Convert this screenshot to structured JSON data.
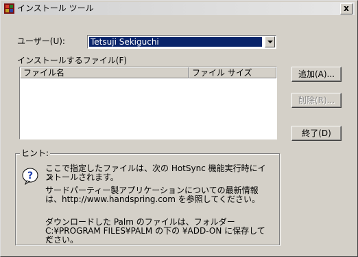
{
  "window": {
    "title": "インストール ツール",
    "close_label": "x"
  },
  "user": {
    "label": "ユーザー(U):",
    "selected": "Tetsuji Sekiguchi"
  },
  "files": {
    "label": "インストールするファイル(F)",
    "columns": [
      "ファイル名",
      "ファイル サイズ"
    ],
    "rows": []
  },
  "buttons": {
    "add": "追加(A)...",
    "delete": "削除(R)...",
    "exit": "終了(D)"
  },
  "hints": {
    "legend": "ヒント:",
    "line1a": "ここで指定したファイルは、次の HotSync 機能実行時にイン",
    "line1b": "ストールされます。",
    "line2a": "サードパーティー製アプリケーションについての最新情報",
    "line2b": "は、http://www.handspring.com を参照してください。",
    "line3a": "ダウンロードした Palm のファイルは、フォルダー",
    "line3b": "C:¥PROGRAM FILES¥PALM の下の ¥ADD-ON に保存してく",
    "line3c": "ださい。"
  },
  "colors": {
    "selection": "#0a246a",
    "face": "#d4d0c8",
    "help_icon": "#1f3fb0"
  }
}
